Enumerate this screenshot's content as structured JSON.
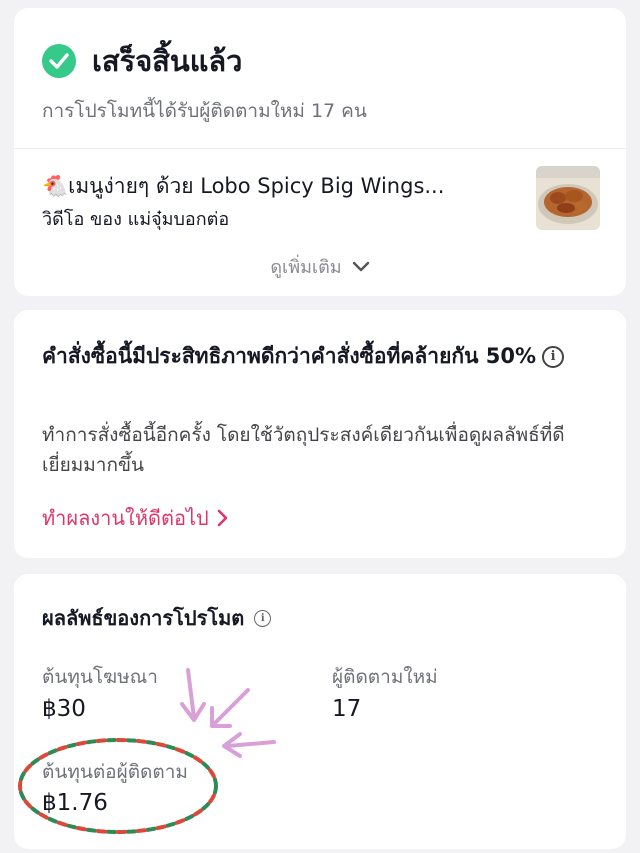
{
  "status": {
    "title": "เสร็จสิ้นแล้ว",
    "subtitle": "การโปรโมทนี้ได้รับผู้ติดตามใหม่ 17 คน",
    "video_title": "🐔เมนูง่ายๆ ด้วย Lobo Spicy Big Wings...",
    "video_sub": "วิดีโอ ของ แม่จุ๋มบอกต่อ",
    "see_more": "ดูเพิ่มเติม"
  },
  "performance": {
    "title": "คำสั่งซื้อนี้มีประสิทธิภาพดีกว่าคำสั่งซื้อที่คล้ายกัน 50%",
    "description": "ทำการสั่งซื้อนี้อีกครั้ง โดยใช้วัตถุประสงค์เดียวกันเพื่อดูผลลัพธ์ที่ดีเยี่ยมมากขึ้น",
    "link": "ทำผลงานให้ดีต่อไป"
  },
  "results": {
    "title": "ผลลัพธ์ของการโปรโมต",
    "metrics": [
      {
        "label": "ต้นทุนโฆษณา",
        "value": "฿30"
      },
      {
        "label": "ผู้ติดตามใหม่",
        "value": "17"
      },
      {
        "label": "ต้นทุนต่อผู้ติดตาม",
        "value": "฿1.76"
      }
    ]
  },
  "colors": {
    "success": "#35c98a",
    "link": "#e0356a",
    "annotation_arrow": "#d9a0d8",
    "annotation_dash_green": "#2e8a57",
    "annotation_dash_red": "#d94a3a"
  },
  "icons": [
    "check-circle-icon",
    "chevron-down-icon",
    "info-icon",
    "chevron-right-icon"
  ]
}
